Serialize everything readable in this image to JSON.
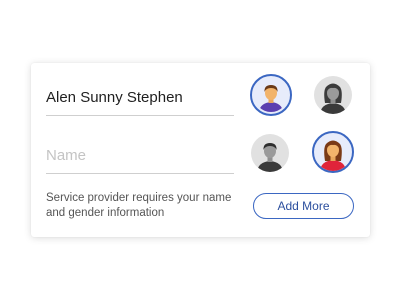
{
  "form": {
    "name_value": "Alen Sunny Stephen",
    "name_placeholder": "Name",
    "hint": "Service provider requires your name and gender information",
    "add_more_label": "Add More"
  },
  "avatars": [
    {
      "icon": "male-avatar-icon",
      "selected": true
    },
    {
      "icon": "female-avatar-icon",
      "selected": false
    },
    {
      "icon": "male-avatar-icon",
      "selected": false
    },
    {
      "icon": "female-avatar-icon",
      "selected": true
    }
  ],
  "colors": {
    "accent": "#3b67c2",
    "selected_bg": "#e7ecfb",
    "unselected_bg": "#e1e1e1",
    "male_shirt": "#5b3fb0",
    "female_shirt": "#e0243a",
    "skin": "#f2b46b"
  }
}
